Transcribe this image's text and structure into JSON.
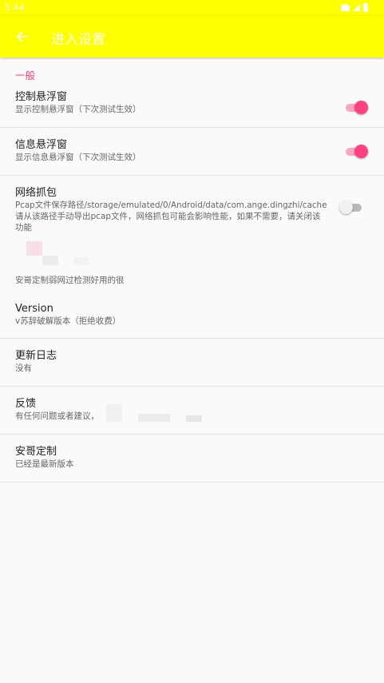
{
  "status_bar": {
    "time": "5:44"
  },
  "app_bar": {
    "title": "进入设置",
    "back_icon": "arrow-left-icon"
  },
  "settings": {
    "category": "一般",
    "control_float": {
      "title": "控制悬浮窗",
      "summary": "显示控制悬浮窗（下次测试生效）",
      "enabled": true
    },
    "info_float": {
      "title": "信息悬浮窗",
      "summary": "显示信息悬浮窗（下次测试生效）",
      "enabled": true
    },
    "network_capture": {
      "title": "网络抓包",
      "summary_path": "Pcap文件保存路径/storage/emulated/0/Android/data/com.ange.dingzhi/cache",
      "summary": "请从该路径手动导出pcap文件，网络抓包可能会影响性能，如果不需要，请关闭该功能",
      "enabled": false
    },
    "weak_network": {
      "summary": "安哥定制弱网过检测好用的很"
    },
    "version": {
      "title": "Version",
      "summary": "v苏辞破解版本（拒绝收费）"
    },
    "changelog": {
      "title": "更新日志",
      "summary": "没有"
    },
    "feedback": {
      "title": "反馈",
      "summary": "有任何问题或者建议，"
    },
    "custom": {
      "title": "安哥定制",
      "summary": "已经是最新版本"
    }
  },
  "colors": {
    "toolbar": "#ffff00",
    "accent": "#ff4081"
  }
}
